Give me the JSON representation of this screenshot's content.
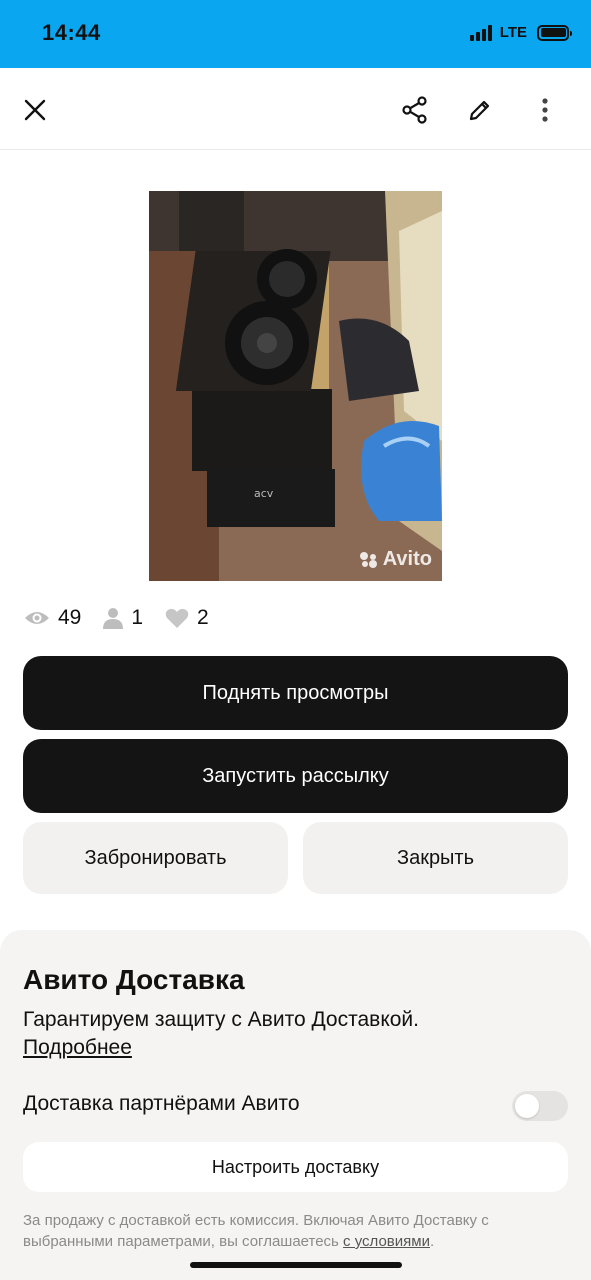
{
  "status_bar": {
    "time": "14:44",
    "network": "LTE",
    "signal_bars": 4,
    "battery_level": 1.0
  },
  "nav": {
    "icons": [
      "close-icon",
      "share-icon",
      "edit-icon",
      "more-vertical-icon"
    ]
  },
  "photo": {
    "watermark": "Avito",
    "amp_brand": "acv"
  },
  "stats": {
    "views": "49",
    "contacts": "1",
    "favorites": "2"
  },
  "actions": {
    "boost_label": "Поднять просмотры",
    "mailing_label": "Запустить рассылку",
    "reserve_label": "Забронировать",
    "close_label": "Закрыть"
  },
  "delivery": {
    "title": "Авито Доставка",
    "subtitle": "Гарантируем защиту с Авито Доставкой.",
    "more_link": "Подробнее",
    "partner_label": "Доставка партнёрами Авито",
    "partner_enabled": false,
    "setup_label": "Настроить доставку",
    "legal_text": "За продажу с доставкой есть комиссия. Включая Авито Доставку с выбранными параметрами, вы соглашаетесь ",
    "legal_link": "с условиями",
    "legal_end": "."
  },
  "colors": {
    "status_bar": "#0aa7f0",
    "primary_button": "#141414",
    "secondary_button": "#f2f1f0",
    "delivery_panel": "#f5f4f2"
  }
}
